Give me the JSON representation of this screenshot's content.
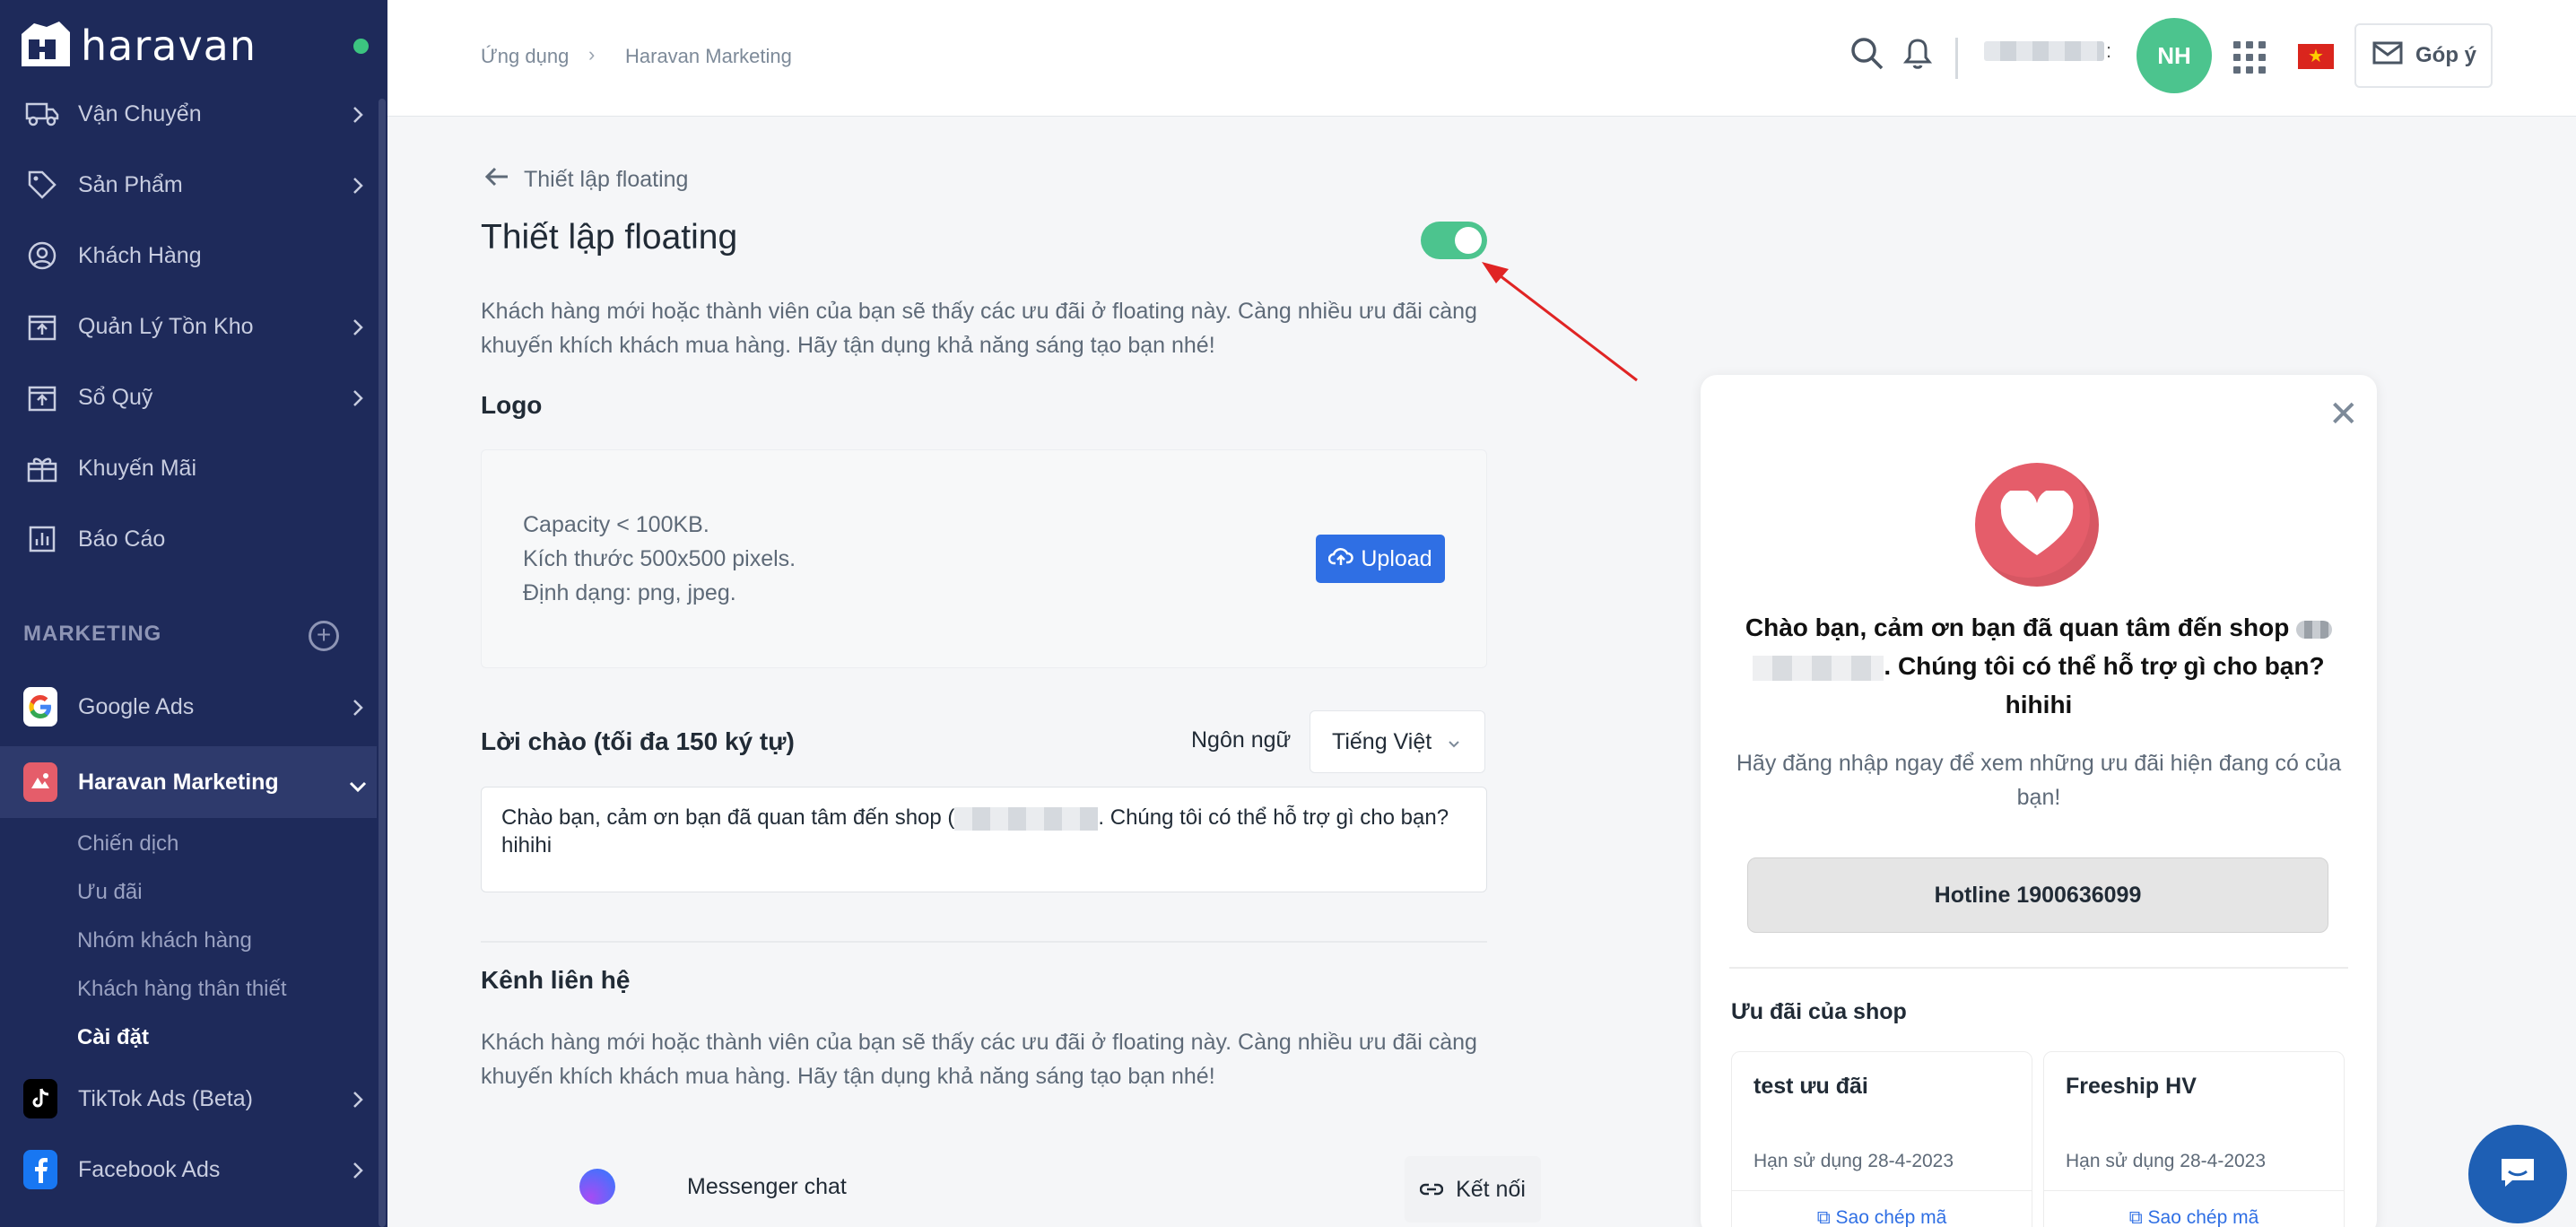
{
  "brand": {
    "name": "haravan"
  },
  "sidebar": {
    "items": [
      {
        "label": "Vận Chuyển",
        "icon": "truck-icon"
      },
      {
        "label": "Sản Phẩm",
        "icon": "tag-icon"
      },
      {
        "label": "Khách Hàng",
        "icon": "user-circle-icon"
      },
      {
        "label": "Quản Lý Tồn Kho",
        "icon": "inventory-icon"
      },
      {
        "label": "Sổ Quỹ",
        "icon": "cashbook-icon"
      },
      {
        "label": "Khuyến Mãi",
        "icon": "gift-icon"
      },
      {
        "label": "Báo Cáo",
        "icon": "report-icon"
      }
    ],
    "marketing_header": "MARKETING",
    "apps": [
      {
        "label": "Google Ads",
        "icon": "google-icon"
      },
      {
        "label": "Haravan Marketing",
        "icon": "haravan-marketing-icon"
      }
    ],
    "sub_items": [
      "Chiến dịch",
      "Ưu đãi",
      "Nhóm khách hàng",
      "Khách hàng thân thiết",
      "Cài đặt"
    ],
    "apps_bottom": [
      {
        "label": "TikTok Ads (Beta)",
        "icon": "tiktok-icon"
      },
      {
        "label": "Facebook Ads",
        "icon": "facebook-icon"
      }
    ]
  },
  "topbar": {
    "breadcrumb": [
      "Ứng dụng",
      "Haravan Marketing"
    ],
    "breadcrumb_sep": "›",
    "avatar_initials": "NH",
    "feedback_label": "Góp ý",
    "name_colon": ":"
  },
  "main": {
    "back_label": "Thiết lập floating",
    "title": "Thiết lập floating",
    "toggle_on": true,
    "description": "Khách hàng mới hoặc thành viên của bạn sẽ thấy các ưu đãi ở floating này. Càng nhiều ưu đãi càng khuyến khích khách mua hàng. Hãy tận dụng khả năng sáng tạo bạn nhé!",
    "logo_heading": "Logo",
    "logo_info": [
      "Capacity < 100KB.",
      "Kích thước 500x500 pixels.",
      "Định dạng: png, jpeg."
    ],
    "upload_label": "Upload",
    "greeting_heading": "Lời chào (tối đa 150 ký tự)",
    "language_label": "Ngôn ngữ",
    "language_value": "Tiếng Việt",
    "greeting_text_before": "Chào bạn, cảm ơn bạn đã quan tâm đến shop (",
    "greeting_text_after": ". Chúng tôi có thể hỗ trợ gì cho bạn? hihihi",
    "contact_heading": "Kênh liên hệ",
    "contact_description": "Khách hàng mới hoặc thành viên của bạn sẽ thấy các ưu đãi ở floating này. Càng nhiều ưu đãi càng khuyến khích khách mua hàng. Hãy tận dụng khả năng sáng tạo bạn nhé!",
    "channels": [
      {
        "label": "Messenger chat",
        "icon": "messenger-icon",
        "action": "Kết nối"
      }
    ]
  },
  "preview": {
    "title_before": "Chào bạn, cảm ơn bạn đã quan tâm đến shop",
    "title_after": ". Chúng tôi có thể hỗ trợ gì cho bạn? hihihi",
    "subtitle": "Hãy đăng nhập ngay để xem những ưu đãi hiện đang có của bạn!",
    "hotline": "Hotline 1900636099",
    "offers_heading": "Ưu đãi của shop",
    "offers": [
      {
        "name": "test ưu đãi",
        "expiry": "Hạn sử dụng 28-4-2023",
        "copy": "Sao chép mã"
      },
      {
        "name": "Freeship HV",
        "expiry": "Hạn sử dụng 28-4-2023",
        "copy": "Sao chép mã"
      }
    ]
  },
  "colors": {
    "sidebar_bg": "#1e2a5a",
    "accent": "#2f6fe4",
    "toggle_on": "#4cc48e",
    "heart": "#e55d6a"
  }
}
